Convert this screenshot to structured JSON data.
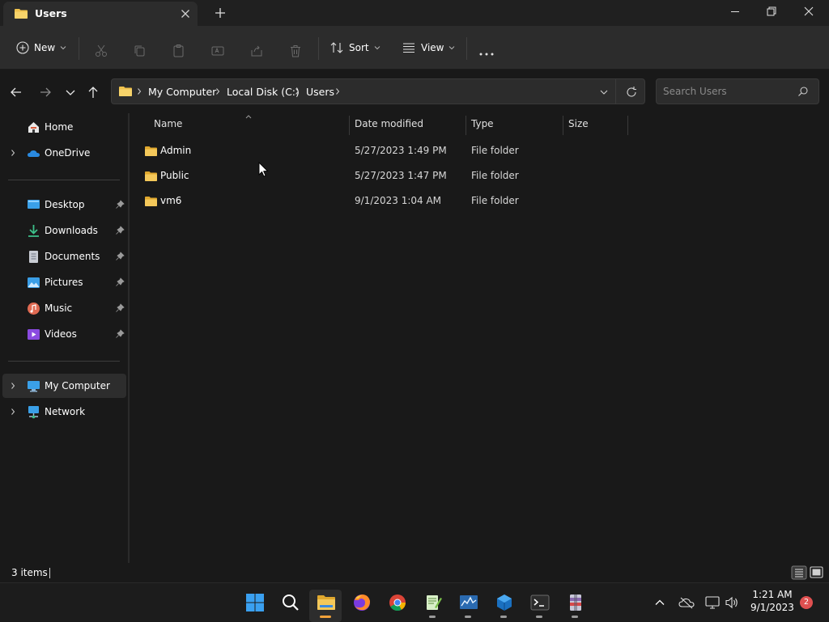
{
  "window": {
    "tab_title": "Users",
    "colors": {
      "bg": "#191919",
      "titlebar": "#202020",
      "toolbar": "#2c2c2c",
      "accent_folder": "#f0c24d",
      "selection": "#2d2d2d"
    }
  },
  "toolbar": {
    "new_label": "New",
    "sort_label": "Sort",
    "view_label": "View"
  },
  "address": {
    "crumbs": [
      "My Computer",
      "Local Disk (C:)",
      "Users"
    ]
  },
  "search": {
    "placeholder": "Search Users"
  },
  "sidebar": {
    "items": [
      {
        "label": "Home",
        "icon": "home-icon"
      },
      {
        "label": "OneDrive",
        "icon": "cloud-icon"
      },
      {
        "label": "Desktop",
        "icon": "desktop-icon"
      },
      {
        "label": "Downloads",
        "icon": "download-icon"
      },
      {
        "label": "Documents",
        "icon": "document-icon"
      },
      {
        "label": "Pictures",
        "icon": "pictures-icon"
      },
      {
        "label": "Music",
        "icon": "music-icon"
      },
      {
        "label": "Videos",
        "icon": "video-icon"
      },
      {
        "label": "My Computer",
        "icon": "computer-icon"
      },
      {
        "label": "Network",
        "icon": "network-icon"
      }
    ]
  },
  "columns": [
    "Name",
    "Date modified",
    "Type",
    "Size"
  ],
  "files": [
    {
      "name": "Admin",
      "date": "5/27/2023 1:49 PM",
      "type": "File folder",
      "size": ""
    },
    {
      "name": "Public",
      "date": "5/27/2023 1:47 PM",
      "type": "File folder",
      "size": ""
    },
    {
      "name": "vm6",
      "date": "9/1/2023 1:04 AM",
      "type": "File folder",
      "size": ""
    }
  ],
  "status": {
    "count": "3 items"
  },
  "taskbar": {
    "time": "1:21 AM",
    "date": "9/1/2023",
    "notifications": "2"
  }
}
